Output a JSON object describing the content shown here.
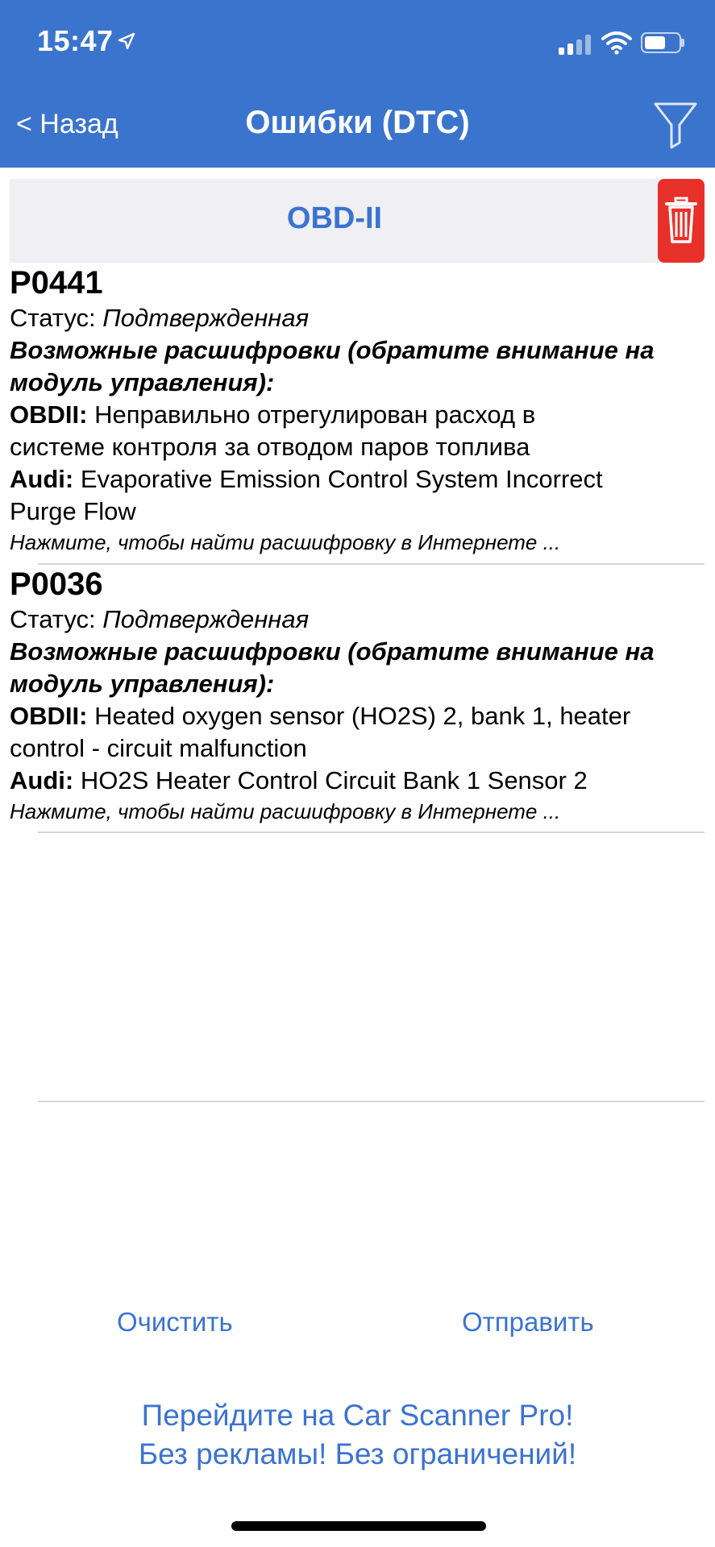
{
  "status_bar": {
    "time": "15:47",
    "icons": [
      "location-arrow-icon",
      "cellular-signal-icon",
      "wifi-icon",
      "battery-icon"
    ]
  },
  "nav": {
    "back_label": "< Назад",
    "title": "Ошибки (DTC)",
    "filter_icon": "filter-funnel-icon"
  },
  "section": {
    "title": "OBD-II",
    "delete_icon": "trash-icon",
    "delete_color": "#e8302a"
  },
  "errors": [
    {
      "code": "P0441",
      "status_label": "Статус:",
      "status_value": "Подтвержденная",
      "decodings_header_line1": "Возможные расшифровки (обратите внимание на",
      "decodings_header_line2": "модуль управления):",
      "obdii_label": "OBDII:",
      "obdii_text_line1": "Неправильно отрегулирован расход в",
      "obdii_text_line2": "системе контроля за отводом паров топлива",
      "audi_label": "Audi:",
      "audi_text_line1": "Evaporative Emission Control System Incorrect",
      "audi_text_line2": "Purge Flow",
      "hint": "Нажмите, чтобы найти расшифровку в Интернете ..."
    },
    {
      "code": "P0036",
      "status_label": "Статус:",
      "status_value": "Подтвержденная",
      "decodings_header_line1": "Возможные расшифровки (обратите внимание на",
      "decodings_header_line2": "модуль управления):",
      "obdii_label": "OBDII:",
      "obdii_text_line1": "Heated oxygen sensor (HO2S) 2, bank 1, heater",
      "obdii_text_line2": "control - circuit malfunction",
      "audi_label": "Audi:",
      "audi_text_line1": "HO2S Heater Control Circuit Bank 1 Sensor 2",
      "hint": "Нажмите, чтобы найти расшифровку в Интернете ..."
    }
  ],
  "actions": {
    "clear_label": "Очистить",
    "send_label": "Отправить"
  },
  "promo": {
    "line1": "Перейдите на Car Scanner Pro!",
    "line2": "Без рекламы! Без ограничений!"
  },
  "colors": {
    "header_bg": "#3a74cd",
    "accent": "#3b73d1",
    "section_bg": "#efeff4"
  }
}
